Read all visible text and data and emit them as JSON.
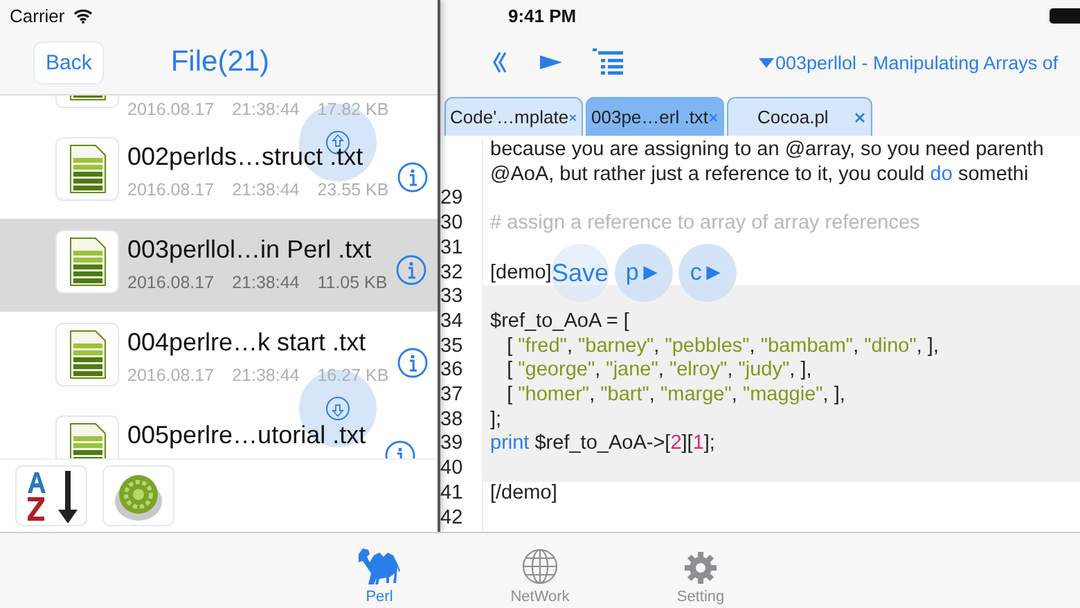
{
  "status_bar": {
    "carrier": "Carrier",
    "time": "9:41 PM"
  },
  "file_panel": {
    "back": "Back",
    "title": "File(21)",
    "files": [
      {
        "date": "2016.08.17",
        "time": "21:38:44",
        "size": "17.82 KB",
        "selected": false
      },
      {
        "name": "002perlds…struct .txt",
        "date": "2016.08.17",
        "time": "21:38:44",
        "size": "23.55 KB",
        "selected": false
      },
      {
        "name": "003perllol…in Perl .txt",
        "date": "2016.08.17",
        "time": "21:38:44",
        "size": "11.05 KB",
        "selected": true
      },
      {
        "name": "004perlre…k start .txt",
        "date": "2016.08.17",
        "time": "21:38:44",
        "size": "16.27 KB",
        "selected": false
      },
      {
        "name": "005perlre…utorial .txt",
        "selected": false
      }
    ]
  },
  "editor": {
    "title": "003perllol - Manipulating Arrays of",
    "tabs": [
      {
        "label": "Code'…mplate",
        "selected": false
      },
      {
        "label": "003pe…erl .txt",
        "selected": true
      },
      {
        "label": "Cocoa.pl",
        "selected": false
      }
    ],
    "lines": [
      {
        "highlighted": false,
        "tokens": [
          {
            "kind": "text",
            "text": "because you are assigning to an @array, so you need parenth"
          }
        ]
      },
      {
        "highlighted": false,
        "tokens": [
          {
            "kind": "text",
            "text": "@AoA, but rather just a reference to it, you could "
          },
          {
            "kind": "keyword",
            "text": "do"
          },
          {
            "kind": "text",
            "text": " somethi"
          }
        ]
      },
      {
        "number": "29",
        "highlighted": false
      },
      {
        "number": "30",
        "highlighted": false,
        "tokens": [
          {
            "kind": "comment",
            "text": "# assign a reference to array of array references"
          }
        ]
      },
      {
        "number": "31",
        "highlighted": false
      },
      {
        "number": "32",
        "highlighted": false,
        "tokens": [
          {
            "kind": "text",
            "text": "[demo]"
          }
        ]
      },
      {
        "number": "33",
        "highlighted": true
      },
      {
        "number": "34",
        "highlighted": true,
        "tokens": [
          {
            "kind": "text",
            "text": "$ref_to_AoA = ["
          }
        ]
      },
      {
        "number": "35",
        "highlighted": true,
        "tokens": [
          {
            "kind": "text",
            "text": "   [ "
          },
          {
            "kind": "string",
            "text": "\"fred\""
          },
          {
            "kind": "text",
            "text": ", "
          },
          {
            "kind": "string",
            "text": "\"barney\""
          },
          {
            "kind": "text",
            "text": ", "
          },
          {
            "kind": "string",
            "text": "\"pebbles\""
          },
          {
            "kind": "text",
            "text": ", "
          },
          {
            "kind": "string",
            "text": "\"bambam\""
          },
          {
            "kind": "text",
            "text": ", "
          },
          {
            "kind": "string",
            "text": "\"dino\""
          },
          {
            "kind": "text",
            "text": ", ],"
          }
        ]
      },
      {
        "number": "36",
        "highlighted": true,
        "tokens": [
          {
            "kind": "text",
            "text": "   [ "
          },
          {
            "kind": "string",
            "text": "\"george\""
          },
          {
            "kind": "text",
            "text": ", "
          },
          {
            "kind": "string",
            "text": "\"jane\""
          },
          {
            "kind": "text",
            "text": ", "
          },
          {
            "kind": "string",
            "text": "\"elroy\""
          },
          {
            "kind": "text",
            "text": ", "
          },
          {
            "kind": "string",
            "text": "\"judy\""
          },
          {
            "kind": "text",
            "text": ", ],"
          }
        ]
      },
      {
        "number": "37",
        "highlighted": true,
        "tokens": [
          {
            "kind": "text",
            "text": "   [ "
          },
          {
            "kind": "string",
            "text": "\"homer\""
          },
          {
            "kind": "text",
            "text": ", "
          },
          {
            "kind": "string",
            "text": "\"bart\""
          },
          {
            "kind": "text",
            "text": ", "
          },
          {
            "kind": "string",
            "text": "\"marge\""
          },
          {
            "kind": "text",
            "text": ", "
          },
          {
            "kind": "string",
            "text": "\"maggie\""
          },
          {
            "kind": "text",
            "text": ", ],"
          }
        ]
      },
      {
        "number": "38",
        "highlighted": true,
        "tokens": [
          {
            "kind": "text",
            "text": "];"
          }
        ]
      },
      {
        "number": "39",
        "highlighted": true,
        "tokens": [
          {
            "kind": "keyword",
            "text": "print"
          },
          {
            "kind": "text",
            "text": " $ref_to_AoA->["
          },
          {
            "kind": "number",
            "text": "2"
          },
          {
            "kind": "text",
            "text": "]["
          },
          {
            "kind": "number",
            "text": "1"
          },
          {
            "kind": "text",
            "text": "];"
          }
        ]
      },
      {
        "number": "40",
        "highlighted": true
      },
      {
        "number": "41",
        "highlighted": false,
        "tokens": [
          {
            "kind": "text",
            "text": "[/demo]"
          }
        ]
      },
      {
        "number": "42",
        "highlighted": false
      }
    ],
    "floating_buttons": [
      "Save",
      "p►",
      "c►"
    ]
  },
  "tab_bar": [
    {
      "kind": "camel",
      "label": "Perl",
      "selected": true
    },
    {
      "kind": "globe",
      "label": "NetWork",
      "selected": false
    },
    {
      "kind": "gear",
      "label": "Setting",
      "selected": false
    }
  ]
}
